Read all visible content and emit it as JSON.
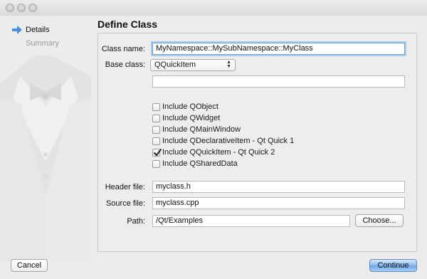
{
  "sidebar": {
    "items": [
      {
        "label": "Details",
        "active": true
      },
      {
        "label": "Summary",
        "active": false
      }
    ]
  },
  "page_title": "Define Class",
  "form": {
    "class_name": {
      "label": "Class name:",
      "value": "MyNamespace::MySubNamespace::MyClass"
    },
    "base_class": {
      "label": "Base class:",
      "value": "QQuickItem",
      "extra_value": ""
    },
    "includes": [
      {
        "label": "Include QObject",
        "checked": false
      },
      {
        "label": "Include QWidget",
        "checked": false
      },
      {
        "label": "Include QMainWindow",
        "checked": false
      },
      {
        "label": "Include QDeclarativeItem - Qt Quick 1",
        "checked": false
      },
      {
        "label": "Include QQuickItem - Qt Quick 2",
        "checked": true
      },
      {
        "label": "Include QSharedData",
        "checked": false
      }
    ],
    "header_file": {
      "label": "Header file:",
      "value": "myclass.h"
    },
    "source_file": {
      "label": "Source file:",
      "value": "myclass.cpp"
    },
    "path": {
      "label": "Path:",
      "value": "/Qt/Examples",
      "button": "Choose..."
    }
  },
  "footer": {
    "cancel": "Cancel",
    "continue": "Continue"
  },
  "colors": {
    "accent": "#6fa7e6",
    "focus_ring": "#a9c9ee",
    "nav_arrow": "#4a8fd9"
  }
}
